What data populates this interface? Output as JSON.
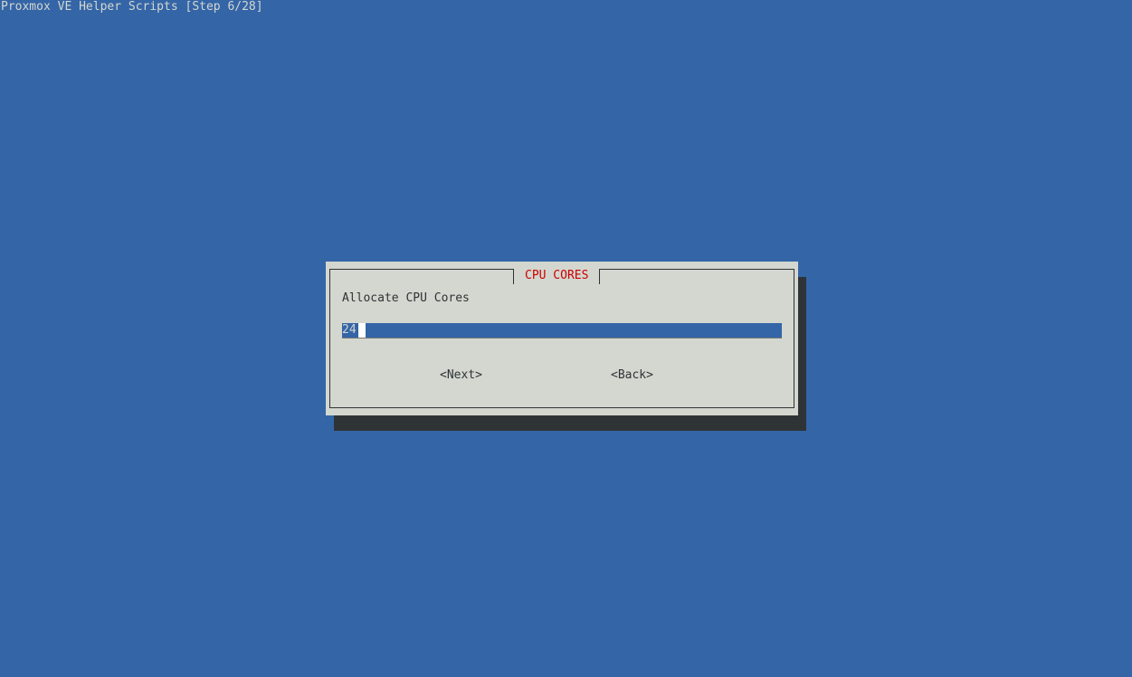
{
  "backtitle": "Proxmox VE Helper Scripts [Step 6/28]",
  "dialog": {
    "title": "CPU CORES",
    "prompt": "Allocate CPU Cores",
    "input_value": "24",
    "buttons": {
      "next": "<Next>",
      "back": "<Back>"
    }
  },
  "colors": {
    "background": "#3465a7",
    "dialog": "#d3d7cf",
    "shadow": "#2e3436",
    "title": "#cc0000",
    "input_bg": "#3465a7"
  }
}
